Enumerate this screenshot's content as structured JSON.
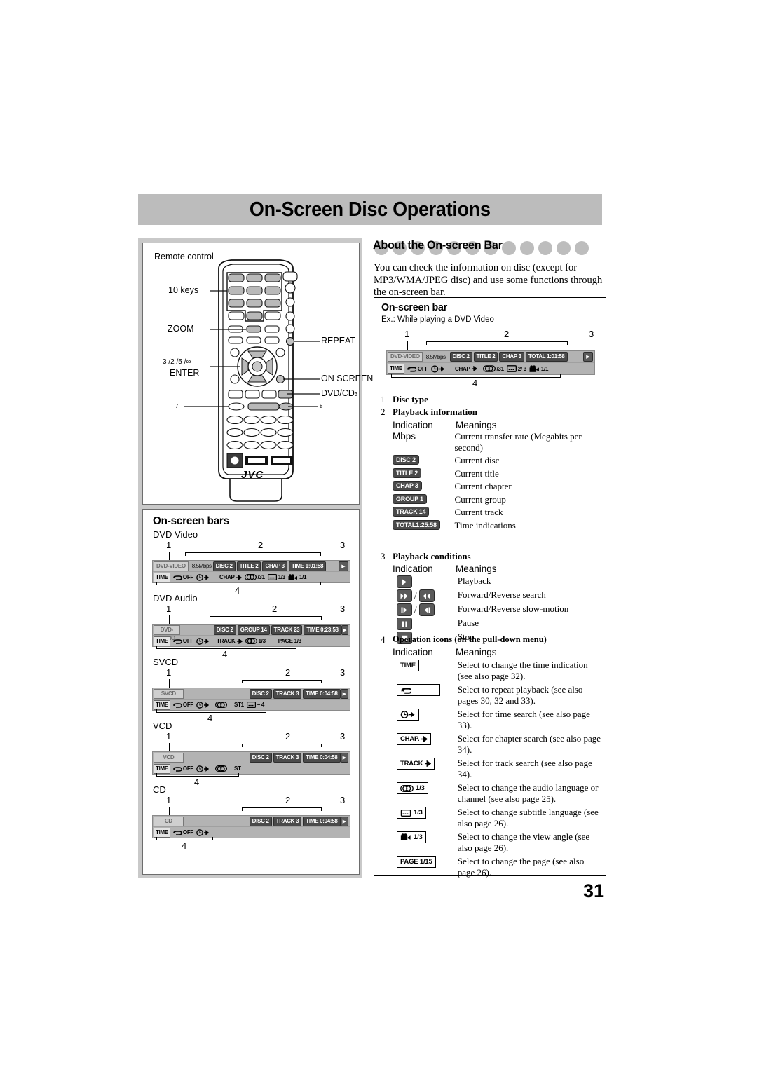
{
  "page": {
    "title": "On-Screen Disc Operations",
    "number": "31"
  },
  "remote_panel": {
    "caption": "Remote control",
    "brand": "JVC",
    "callouts": {
      "ten_keys": "10 keys",
      "zoom": "ZOOM",
      "repeat": "REPEAT",
      "enter_nums": "3 /2 /5 /∞",
      "enter": "ENTER",
      "on_screen": "ON SCREEN",
      "dvd_cd": "DVD/CD",
      "dvd_cd_sub": "3",
      "num_seven": "7",
      "num_eight": "8"
    }
  },
  "bars_panel": {
    "heading": "On-screen bars",
    "marker_1": "1",
    "marker_2": "2",
    "marker_3": "3",
    "marker_4": "4",
    "bars": [
      {
        "label": "DVD Video",
        "type": "DVD-VIDEO",
        "rate": "8.5Mbps",
        "chips": [
          "DISC 2",
          "TITLE  2",
          "CHAP  3",
          "TIME 1:01:58"
        ],
        "menu": [
          "TIME",
          "OFF",
          "",
          "CHAP",
          "/31",
          "1/3",
          "1/1"
        ]
      },
      {
        "label": "DVD Audio",
        "type": "DVD-AUDIO",
        "rate": "",
        "chips": [
          "DISC 2",
          "GROUP 14",
          "TRACK 23",
          "TIME 0:23:58"
        ],
        "menu": [
          "TIME",
          "OFF",
          "",
          "TRACK",
          "1/3",
          "PAGE 1/3"
        ]
      },
      {
        "label": "SVCD",
        "type": "SVCD",
        "rate": "",
        "chips": [
          "DISC 2",
          "TRACK 3",
          "TIME      0:04:58"
        ],
        "menu": [
          "TIME",
          "OFF",
          "",
          "ST1",
          "–  4"
        ]
      },
      {
        "label": "VCD",
        "type": "VCD",
        "rate": "",
        "chips": [
          "DISC 2",
          "TRACK 3",
          "TIME    0:04:58"
        ],
        "menu": [
          "TIME",
          "OFF",
          "",
          "ST"
        ]
      },
      {
        "label": "CD",
        "type": "CD",
        "rate": "",
        "chips": [
          "DISC 2",
          "TRACK 3",
          "TIME      0:04:58"
        ],
        "menu": [
          "TIME",
          "OFF",
          ""
        ]
      }
    ]
  },
  "about": {
    "heading": "About the On-screen Bar",
    "intro": "You can check the information on disc (except for MP3/WMA/JPEG disc) and use some functions through the on-screen bar.",
    "panel_heading": "On-screen bar",
    "example_caption": "Ex.: While playing a DVD Video",
    "example_bar": {
      "type": "DVD-VIDEO",
      "rate": "8.5Mbps",
      "chips": [
        "DISC 2",
        "TITLE  2",
        "CHAP  3",
        "TOTAL 1:01:58"
      ],
      "menu": [
        "TIME",
        "OFF",
        "",
        "CHAP",
        "/31",
        "2/ 3",
        "1/1"
      ]
    },
    "marker_1": "1",
    "marker_2": "2",
    "marker_3": "3",
    "marker_4": "4",
    "sections": [
      {
        "num": "1",
        "title": "Disc type"
      },
      {
        "num": "2",
        "title": "Playback information"
      },
      {
        "num": "3",
        "title": "Playback conditions"
      },
      {
        "num": "4",
        "title": "Operation icons (on the pull-down menu)"
      }
    ],
    "col_headers": {
      "indication": "Indication",
      "meanings": "Meanings"
    },
    "playback_information": [
      {
        "indication": "Mbps",
        "kind": "text",
        "meaning": "Current transfer rate (Megabits per second)"
      },
      {
        "indication": "DISC 2",
        "kind": "tag-dark",
        "meaning": "Current disc"
      },
      {
        "indication": "TITLE  2",
        "kind": "tag-dark",
        "meaning": "Current title"
      },
      {
        "indication": "CHAP  3",
        "kind": "tag-dark",
        "meaning": "Current chapter"
      },
      {
        "indication": "GROUP 1",
        "kind": "tag-dark",
        "meaning": "Current group"
      },
      {
        "indication": "TRACK 14",
        "kind": "tag-dark",
        "meaning": "Current track"
      },
      {
        "indication": "TOTAL1:25:58",
        "kind": "tag-dark",
        "meaning": "Time indications"
      }
    ],
    "playback_conditions": [
      {
        "icon": "play-icon",
        "meaning": "Playback"
      },
      {
        "icon": "forward-reverse-search-icon",
        "meaning": "Forward/Reverse search"
      },
      {
        "icon": "forward-reverse-slow-icon",
        "meaning": "Forward/Reverse slow-motion"
      },
      {
        "icon": "pause-icon",
        "meaning": "Pause"
      },
      {
        "icon": "stop-icon",
        "meaning": "Stop"
      }
    ],
    "operation_icons": [
      {
        "indication": "TIME",
        "icon": "time-icon",
        "meaning": "Select to change the time indication (see also page 32)."
      },
      {
        "indication": "",
        "icon": "repeat-icon",
        "meaning": "Select to repeat playback (see also pages 30, 32 and 33)."
      },
      {
        "indication": "",
        "icon": "time-search-icon",
        "meaning": "Select for time search (see also page 33)."
      },
      {
        "indication": "CHAP.",
        "icon": "chapter-search-icon",
        "meaning": "Select for chapter search (see also page 34)."
      },
      {
        "indication": "TRACK",
        "icon": "track-search-icon",
        "meaning": "Select for track search (see also page 34)."
      },
      {
        "indication": "1/3",
        "icon": "audio-icon",
        "meaning": "Select to change the audio language or channel (see also page 25)."
      },
      {
        "indication": "1/3",
        "icon": "subtitle-icon",
        "meaning": "Select to change subtitle language (see also page 26)."
      },
      {
        "indication": "1/3",
        "icon": "angle-icon",
        "meaning": "Select to change the view angle (see also page 26)."
      },
      {
        "indication": "PAGE 1/15",
        "icon": "page-icon",
        "meaning": "Select to change the page (see also page 26)."
      }
    ]
  }
}
